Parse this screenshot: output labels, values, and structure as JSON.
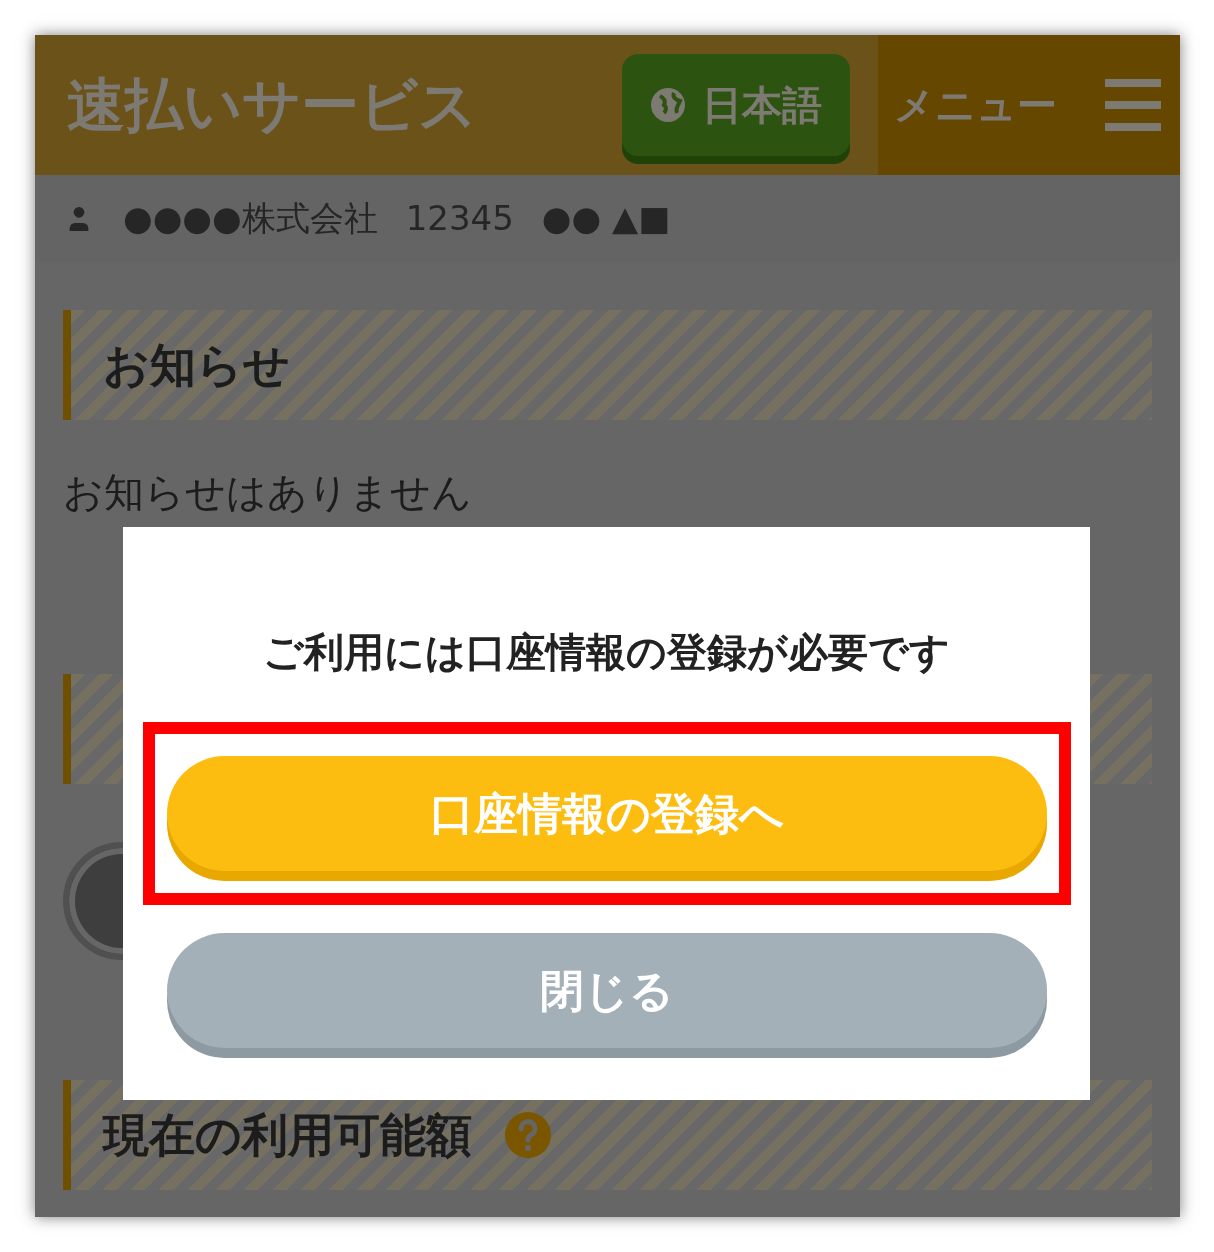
{
  "header": {
    "title": "速払いサービス",
    "language_button": "日本語",
    "menu_label": "メニュー"
  },
  "user_bar": {
    "company": "●●●●株式会社",
    "id": "12345",
    "name": "●● ▲■"
  },
  "sections": [
    {
      "kind": "heading",
      "title": "お知らせ"
    },
    {
      "kind": "text",
      "text": "お知らせはありません"
    },
    {
      "kind": "heading"
    },
    {
      "kind": "circle"
    },
    {
      "kind": "heading",
      "title": "現在の利用可能額",
      "help": true
    }
  ],
  "dialog": {
    "message": "ご利用には口座情報の登録が必要です",
    "buttons": [
      {
        "label": "口座情報の登録へ",
        "kind": "primary",
        "highlighted": true
      },
      {
        "label": "閉じる",
        "kind": "secondary",
        "highlighted": false
      }
    ]
  }
}
